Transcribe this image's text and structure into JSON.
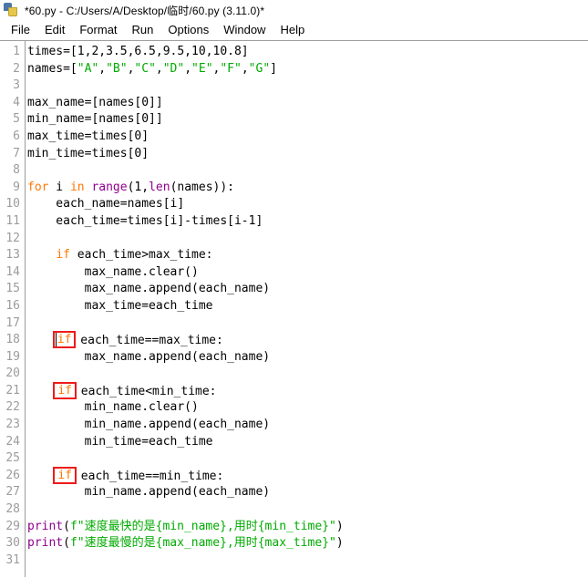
{
  "window": {
    "icon": "python-idle-icon",
    "title": "*60.py - C:/Users/A/Desktop/临时/60.py (3.11.0)*"
  },
  "menubar": {
    "items": [
      {
        "label": "File"
      },
      {
        "label": "Edit"
      },
      {
        "label": "Format"
      },
      {
        "label": "Run"
      },
      {
        "label": "Options"
      },
      {
        "label": "Window"
      },
      {
        "label": "Help"
      }
    ]
  },
  "colors": {
    "keyword": "#ff7700",
    "builtin": "#900090",
    "string": "#00aa00",
    "definition": "#0000ff",
    "plain": "#000000",
    "lineno": "#9c9c9c",
    "annotation_box": "#ee1b1b",
    "background": "#ffffff"
  },
  "editor": {
    "lines": [
      {
        "n": "1",
        "tokens": [
          {
            "t": "plain",
            "v": "times=[1,2,3.5,6.5,9.5,10,10.8]"
          }
        ]
      },
      {
        "n": "2",
        "tokens": [
          {
            "t": "plain",
            "v": "names=["
          },
          {
            "t": "str",
            "v": "\"A\""
          },
          {
            "t": "plain",
            "v": ","
          },
          {
            "t": "str",
            "v": "\"B\""
          },
          {
            "t": "plain",
            "v": ","
          },
          {
            "t": "str",
            "v": "\"C\""
          },
          {
            "t": "plain",
            "v": ","
          },
          {
            "t": "str",
            "v": "\"D\""
          },
          {
            "t": "plain",
            "v": ","
          },
          {
            "t": "str",
            "v": "\"E\""
          },
          {
            "t": "plain",
            "v": ","
          },
          {
            "t": "str",
            "v": "\"F\""
          },
          {
            "t": "plain",
            "v": ","
          },
          {
            "t": "str",
            "v": "\"G\""
          },
          {
            "t": "plain",
            "v": "]"
          }
        ]
      },
      {
        "n": "3",
        "tokens": []
      },
      {
        "n": "4",
        "tokens": [
          {
            "t": "plain",
            "v": "max_name=[names[0]]"
          }
        ]
      },
      {
        "n": "5",
        "tokens": [
          {
            "t": "plain",
            "v": "min_name=[names[0]]"
          }
        ]
      },
      {
        "n": "6",
        "tokens": [
          {
            "t": "plain",
            "v": "max_time=times[0]"
          }
        ]
      },
      {
        "n": "7",
        "tokens": [
          {
            "t": "plain",
            "v": "min_time=times[0]"
          }
        ]
      },
      {
        "n": "8",
        "tokens": []
      },
      {
        "n": "9",
        "tokens": [
          {
            "t": "kw",
            "v": "for"
          },
          {
            "t": "plain",
            "v": " i "
          },
          {
            "t": "kw",
            "v": "in"
          },
          {
            "t": "plain",
            "v": " "
          },
          {
            "t": "bi",
            "v": "range"
          },
          {
            "t": "plain",
            "v": "(1,"
          },
          {
            "t": "bi",
            "v": "len"
          },
          {
            "t": "plain",
            "v": "(names)):"
          }
        ]
      },
      {
        "n": "10",
        "tokens": [
          {
            "t": "plain",
            "v": "    each_name=names[i]"
          }
        ]
      },
      {
        "n": "11",
        "tokens": [
          {
            "t": "plain",
            "v": "    each_time=times[i]-times[i-1]"
          }
        ]
      },
      {
        "n": "12",
        "tokens": []
      },
      {
        "n": "13",
        "tokens": [
          {
            "t": "plain",
            "v": "    "
          },
          {
            "t": "kw",
            "v": "if"
          },
          {
            "t": "plain",
            "v": " each_time>max_time:"
          }
        ]
      },
      {
        "n": "14",
        "tokens": [
          {
            "t": "plain",
            "v": "        max_name.clear()"
          }
        ]
      },
      {
        "n": "15",
        "tokens": [
          {
            "t": "plain",
            "v": "        max_name.append(each_name)"
          }
        ]
      },
      {
        "n": "16",
        "tokens": [
          {
            "t": "plain",
            "v": "        max_time=each_time"
          }
        ]
      },
      {
        "n": "17",
        "tokens": []
      },
      {
        "n": "18",
        "tokens": [
          {
            "t": "plain",
            "v": "    "
          },
          {
            "t": "kw",
            "v": "if",
            "box": true,
            "caret": true
          },
          {
            "t": "plain",
            "v": " each_time==max_time:"
          }
        ]
      },
      {
        "n": "19",
        "tokens": [
          {
            "t": "plain",
            "v": "        max_name.append(each_name)"
          }
        ]
      },
      {
        "n": "20",
        "tokens": []
      },
      {
        "n": "21",
        "tokens": [
          {
            "t": "plain",
            "v": "    "
          },
          {
            "t": "kw",
            "v": "if",
            "box": true
          },
          {
            "t": "plain",
            "v": " each_time<min_time:"
          }
        ]
      },
      {
        "n": "22",
        "tokens": [
          {
            "t": "plain",
            "v": "        min_name.clear()"
          }
        ]
      },
      {
        "n": "23",
        "tokens": [
          {
            "t": "plain",
            "v": "        min_name.append(each_name)"
          }
        ]
      },
      {
        "n": "24",
        "tokens": [
          {
            "t": "plain",
            "v": "        min_time=each_time"
          }
        ]
      },
      {
        "n": "25",
        "tokens": []
      },
      {
        "n": "26",
        "tokens": [
          {
            "t": "plain",
            "v": "    "
          },
          {
            "t": "kw",
            "v": "if",
            "box": true
          },
          {
            "t": "plain",
            "v": " each_time==min_time:"
          }
        ]
      },
      {
        "n": "27",
        "tokens": [
          {
            "t": "plain",
            "v": "        min_name.append(each_name)"
          }
        ]
      },
      {
        "n": "28",
        "tokens": []
      },
      {
        "n": "29",
        "tokens": [
          {
            "t": "bi",
            "v": "print"
          },
          {
            "t": "plain",
            "v": "("
          },
          {
            "t": "str",
            "v": "f\"速度最快的是{min_name},用时{min_time}\""
          },
          {
            "t": "plain",
            "v": ")"
          }
        ]
      },
      {
        "n": "30",
        "tokens": [
          {
            "t": "bi",
            "v": "print"
          },
          {
            "t": "plain",
            "v": "("
          },
          {
            "t": "str",
            "v": "f\"速度最慢的是{max_name},用时{max_time}\""
          },
          {
            "t": "plain",
            "v": ")"
          }
        ]
      },
      {
        "n": "31",
        "tokens": []
      }
    ]
  }
}
